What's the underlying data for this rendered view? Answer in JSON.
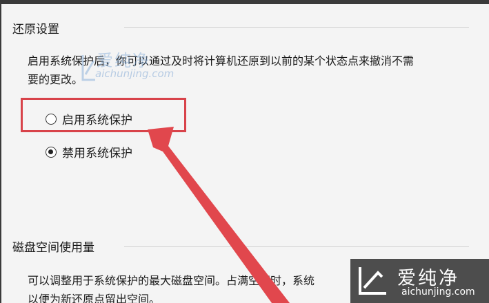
{
  "restore_settings": {
    "title": "还原设置",
    "description_line1": "启用系统保护后，你可以通过及时将计算机还原到以前的某个状态点来撤消不需",
    "description_line2": "要的更改。",
    "options": [
      {
        "label": "启用系统保护",
        "checked": false
      },
      {
        "label": "禁用系统保护",
        "checked": true
      }
    ]
  },
  "disk_usage": {
    "title": "磁盘空间使用量",
    "description_line1": "可以调整用于系统保护的最大磁盘空间。占满空间时，系统",
    "description_line2": "以便为新还原点留出空间。"
  },
  "watermark_small": {
    "cn": "爱纯净",
    "en": "aichunjing.com"
  },
  "watermark_big": {
    "cn": "爱纯净",
    "en": "aichunjing.com"
  },
  "colors": {
    "highlight": "#d8434a",
    "arrow": "#e1474d"
  }
}
